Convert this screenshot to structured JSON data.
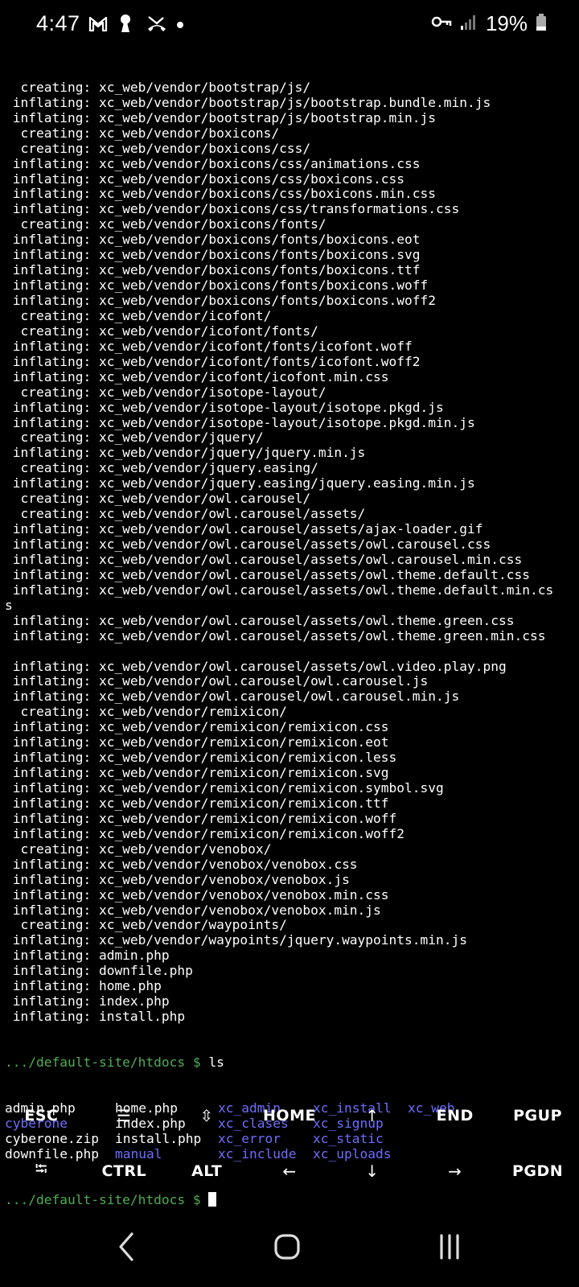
{
  "status_bar": {
    "time": "4:47",
    "battery_text": "19%",
    "left_icons": [
      "gmail-icon",
      "keyhole-icon",
      "missed-call-icon",
      "dot-icon"
    ],
    "right_icons": [
      "vpn-key-icon",
      "signal-icon",
      "battery-icon"
    ]
  },
  "terminal": {
    "lines": [
      "  creating: xc_web/vendor/bootstrap/js/",
      " inflating: xc_web/vendor/bootstrap/js/bootstrap.bundle.min.js",
      " inflating: xc_web/vendor/bootstrap/js/bootstrap.min.js",
      "  creating: xc_web/vendor/boxicons/",
      "  creating: xc_web/vendor/boxicons/css/",
      " inflating: xc_web/vendor/boxicons/css/animations.css",
      " inflating: xc_web/vendor/boxicons/css/boxicons.css",
      " inflating: xc_web/vendor/boxicons/css/boxicons.min.css",
      " inflating: xc_web/vendor/boxicons/css/transformations.css",
      "  creating: xc_web/vendor/boxicons/fonts/",
      " inflating: xc_web/vendor/boxicons/fonts/boxicons.eot",
      " inflating: xc_web/vendor/boxicons/fonts/boxicons.svg",
      " inflating: xc_web/vendor/boxicons/fonts/boxicons.ttf",
      " inflating: xc_web/vendor/boxicons/fonts/boxicons.woff",
      " inflating: xc_web/vendor/boxicons/fonts/boxicons.woff2",
      "  creating: xc_web/vendor/icofont/",
      "  creating: xc_web/vendor/icofont/fonts/",
      " inflating: xc_web/vendor/icofont/fonts/icofont.woff",
      " inflating: xc_web/vendor/icofont/fonts/icofont.woff2",
      " inflating: xc_web/vendor/icofont/icofont.min.css",
      "  creating: xc_web/vendor/isotope-layout/",
      " inflating: xc_web/vendor/isotope-layout/isotope.pkgd.js",
      " inflating: xc_web/vendor/isotope-layout/isotope.pkgd.min.js",
      "  creating: xc_web/vendor/jquery/",
      " inflating: xc_web/vendor/jquery/jquery.min.js",
      "  creating: xc_web/vendor/jquery.easing/",
      " inflating: xc_web/vendor/jquery.easing/jquery.easing.min.js",
      "  creating: xc_web/vendor/owl.carousel/",
      "  creating: xc_web/vendor/owl.carousel/assets/",
      " inflating: xc_web/vendor/owl.carousel/assets/ajax-loader.gif",
      " inflating: xc_web/vendor/owl.carousel/assets/owl.carousel.css",
      " inflating: xc_web/vendor/owl.carousel/assets/owl.carousel.min.css",
      " inflating: xc_web/vendor/owl.carousel/assets/owl.theme.default.css",
      " inflating: xc_web/vendor/owl.carousel/assets/owl.theme.default.min.cs",
      "s",
      " inflating: xc_web/vendor/owl.carousel/assets/owl.theme.green.css",
      " inflating: xc_web/vendor/owl.carousel/assets/owl.theme.green.min.css",
      "",
      " inflating: xc_web/vendor/owl.carousel/assets/owl.video.play.png",
      " inflating: xc_web/vendor/owl.carousel/owl.carousel.js",
      " inflating: xc_web/vendor/owl.carousel/owl.carousel.min.js",
      "  creating: xc_web/vendor/remixicon/",
      " inflating: xc_web/vendor/remixicon/remixicon.css",
      " inflating: xc_web/vendor/remixicon/remixicon.eot",
      " inflating: xc_web/vendor/remixicon/remixicon.less",
      " inflating: xc_web/vendor/remixicon/remixicon.svg",
      " inflating: xc_web/vendor/remixicon/remixicon.symbol.svg",
      " inflating: xc_web/vendor/remixicon/remixicon.ttf",
      " inflating: xc_web/vendor/remixicon/remixicon.woff",
      " inflating: xc_web/vendor/remixicon/remixicon.woff2",
      "  creating: xc_web/vendor/venobox/",
      " inflating: xc_web/vendor/venobox/venobox.css",
      " inflating: xc_web/vendor/venobox/venobox.js",
      " inflating: xc_web/vendor/venobox/venobox.min.css",
      " inflating: xc_web/vendor/venobox/venobox.min.js",
      "  creating: xc_web/vendor/waypoints/",
      " inflating: xc_web/vendor/waypoints/jquery.waypoints.min.js",
      " inflating: admin.php",
      " inflating: downfile.php",
      " inflating: home.php",
      " inflating: index.php",
      " inflating: install.php"
    ],
    "prompt": ".../default-site/htdocs $",
    "ls_command": " ls",
    "ls_rows": [
      [
        {
          "name": "admin.php",
          "kind": "file"
        },
        {
          "name": "home.php",
          "kind": "file"
        },
        {
          "name": "xc_admin",
          "kind": "dir"
        },
        {
          "name": "xc_install",
          "kind": "dir"
        },
        {
          "name": "xc_web",
          "kind": "dir"
        }
      ],
      [
        {
          "name": "cyberone",
          "kind": "dir"
        },
        {
          "name": "index.php",
          "kind": "file"
        },
        {
          "name": "xc_clases",
          "kind": "dir"
        },
        {
          "name": "xc_signup",
          "kind": "dir"
        },
        {
          "name": "",
          "kind": "file"
        }
      ],
      [
        {
          "name": "cyberone.zip",
          "kind": "file"
        },
        {
          "name": "install.php",
          "kind": "file"
        },
        {
          "name": "xc_error",
          "kind": "dir"
        },
        {
          "name": "xc_static",
          "kind": "dir"
        },
        {
          "name": "",
          "kind": "file"
        }
      ],
      [
        {
          "name": "downfile.php",
          "kind": "file"
        },
        {
          "name": "manual",
          "kind": "dir"
        },
        {
          "name": "xc_include",
          "kind": "dir"
        },
        {
          "name": "xc_uploads",
          "kind": "dir"
        },
        {
          "name": "",
          "kind": "file"
        }
      ]
    ],
    "final_prompt": ".../default-site/htdocs $ "
  },
  "extra_keys": {
    "row1": [
      {
        "label": "ESC",
        "name": "esc-key"
      },
      {
        "label": "☰",
        "name": "menu-key"
      },
      {
        "label": "⇳",
        "name": "scroll-key"
      },
      {
        "label": "HOME",
        "name": "home-key"
      },
      {
        "label": "↑",
        "name": "up-arrow-key"
      },
      {
        "label": "END",
        "name": "end-key"
      },
      {
        "label": "PGUP",
        "name": "pgup-key"
      }
    ],
    "row2": [
      {
        "label": "⭾",
        "name": "tab-key"
      },
      {
        "label": "CTRL",
        "name": "ctrl-key"
      },
      {
        "label": "ALT",
        "name": "alt-key"
      },
      {
        "label": "←",
        "name": "left-arrow-key"
      },
      {
        "label": "↓",
        "name": "down-arrow-key"
      },
      {
        "label": "→",
        "name": "right-arrow-key"
      },
      {
        "label": "PGDN",
        "name": "pgdn-key"
      }
    ]
  },
  "nav_bar": {
    "buttons": [
      "back-icon",
      "home-icon",
      "recents-icon"
    ]
  },
  "colors": {
    "prompt": "#4caf50",
    "directory": "#6d6dff",
    "background": "#000000",
    "text": "#ffffff"
  }
}
